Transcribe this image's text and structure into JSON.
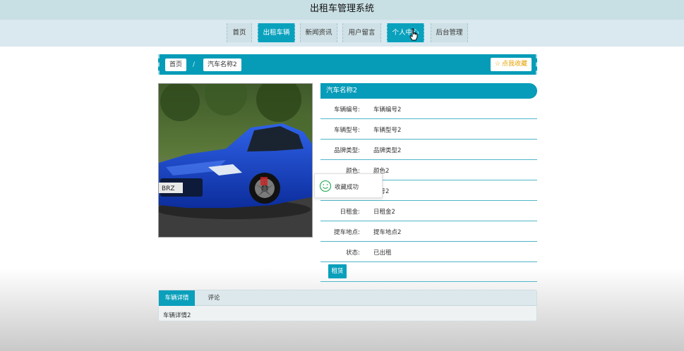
{
  "site_title": "出租车管理系统",
  "nav": {
    "items": [
      {
        "label": "首页"
      },
      {
        "label": "出租车辆"
      },
      {
        "label": "新闻资讯"
      },
      {
        "label": "用户留言"
      },
      {
        "label": "个人中心"
      },
      {
        "label": "后台管理"
      }
    ]
  },
  "breadcrumb": {
    "home": "首页",
    "separator": "/",
    "current": "汽车名称2"
  },
  "favorite_button": "点我收藏",
  "detail": {
    "title": "汽车名称2",
    "rows": [
      {
        "label": "车辆编号:",
        "value": "车辆编号2"
      },
      {
        "label": "车辆型号:",
        "value": "车辆型号2"
      },
      {
        "label": "品牌类型:",
        "value": "品牌类型2"
      },
      {
        "label": "颜色:",
        "value": "颜色2"
      },
      {
        "label": "",
        "value": "牌号2"
      },
      {
        "label": "日租金:",
        "value": "日租金2"
      },
      {
        "label": "提车地点:",
        "value": "提车地点2"
      },
      {
        "label": "状态:",
        "value": "已出租"
      }
    ],
    "rent_button": "租赁"
  },
  "toast": {
    "message": "收藏成功"
  },
  "tabs": {
    "items": [
      {
        "label": "车辆详情"
      },
      {
        "label": "评论"
      }
    ],
    "content": "车辆详情2"
  },
  "colors": {
    "accent": "#079cb9",
    "nav_bg": "#dae8ef",
    "title_bg": "#c8dfe4",
    "favorite": "#e4a300"
  }
}
